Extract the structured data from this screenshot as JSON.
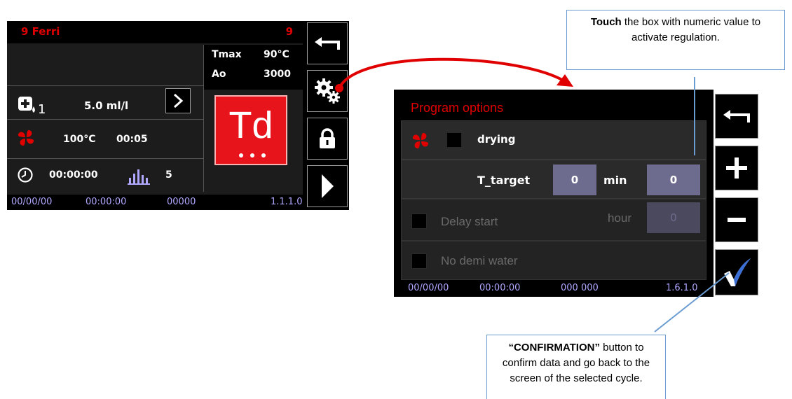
{
  "left": {
    "header": {
      "title": "9 Ferri",
      "number": "9"
    },
    "params": {
      "tmax_label": "Tmax",
      "tmax_value": "90°C",
      "ao_label": "Ao",
      "ao_value": "3000"
    },
    "dose": {
      "sub": "1",
      "value": "5.0 ml/l"
    },
    "fan": {
      "temp": "100°C",
      "time": "00:05"
    },
    "timer": {
      "time": "00:00:00",
      "count": "5"
    },
    "td_label": "Td",
    "footer": {
      "date": "00/00/00",
      "time": "00:00:00",
      "code": "00000",
      "version": "1.1.1.0"
    }
  },
  "right": {
    "title": "Program options",
    "drying_label": "drying",
    "t_target_label": "T_target",
    "t_target_value": "0",
    "min_label": "min",
    "min_value": "0",
    "delay_label": "Delay start",
    "hour_label": "hour",
    "hour_value": "0",
    "demi_label": "No demi water",
    "footer": {
      "date": "00/00/00",
      "time": "00:00:00",
      "code": "000 000",
      "version": "1.6.1.0"
    }
  },
  "callouts": {
    "top_bold": "Touch",
    "top_rest": " the box with numeric value to activate regulation.",
    "bottom_bold": "“CONFIRMATION”",
    "bottom_rest": " button to confirm data and go back to the screen of the selected cycle."
  },
  "colors": {
    "accent_red": "#e00000",
    "value_box": "#6e6c8e",
    "footer_text": "#b0a8ff",
    "callout_border": "#6a9bd1"
  }
}
